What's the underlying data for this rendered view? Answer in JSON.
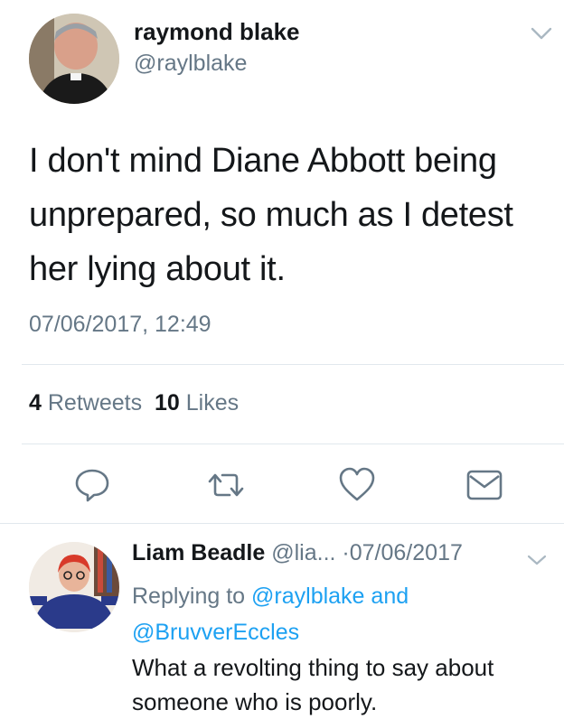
{
  "tweet": {
    "author_name": "raymond blake",
    "author_handle": "@raylblake",
    "text": "I don't mind Diane Abbott being unprepared, so much as I detest her lying about it.",
    "timestamp": "07/06/2017, 12:49",
    "retweets_count": "4",
    "retweets_label": "Retweets",
    "likes_count": "10",
    "likes_label": "Likes"
  },
  "actions": {
    "reply_icon": "reply-icon",
    "retweet_icon": "retweet-icon",
    "like_icon": "heart-icon",
    "dm_icon": "envelope-icon"
  },
  "reply": {
    "author_name": "Liam Beadle",
    "author_handle": "@lia...",
    "separator": "·",
    "date": "07/06/2017",
    "replying_prefix": "Replying to",
    "replying_user1": "@raylblake",
    "replying_and": "and",
    "replying_user2": "@BruvverEccles",
    "text": "What a revolting thing to say about someone who is poorly."
  },
  "colors": {
    "link": "#1da1f2",
    "secondary_text": "#657786",
    "divider": "#e1e8ed"
  }
}
